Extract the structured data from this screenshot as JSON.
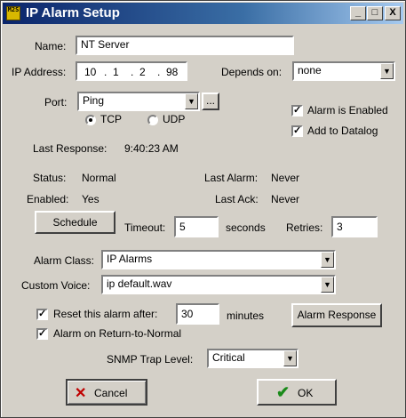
{
  "window": {
    "title": "IP Alarm Setup",
    "icon_text": "M2S"
  },
  "titlebar_buttons": {
    "minimize": "_",
    "maximize": "□",
    "close": "X"
  },
  "name": {
    "label": "Name:",
    "value": "NT Server"
  },
  "ip": {
    "label": "IP Address:",
    "octets": [
      "10",
      "1",
      "2",
      "98"
    ],
    "dot": "."
  },
  "depends": {
    "label": "Depends on:",
    "value": "none"
  },
  "port": {
    "label": "Port:",
    "value": "Ping",
    "browse": "..."
  },
  "protocol": {
    "tcp": "TCP",
    "udp": "UDP",
    "selected": "TCP"
  },
  "alarm_enabled": {
    "label": "Alarm is Enabled",
    "checked": true
  },
  "add_datalog": {
    "label": "Add to Datalog",
    "checked": true
  },
  "last_response": {
    "label": "Last Response:",
    "value": "9:40:23 AM"
  },
  "status": {
    "label": "Status:",
    "value": "Normal"
  },
  "enabled": {
    "label": "Enabled:",
    "value": "Yes"
  },
  "last_alarm": {
    "label": "Last Alarm:",
    "value": "Never"
  },
  "last_ack": {
    "label": "Last Ack:",
    "value": "Never"
  },
  "schedule_label": "Schedule",
  "timeout": {
    "label": "Timeout:",
    "value": "5",
    "unit": "seconds"
  },
  "retries": {
    "label": "Retries:",
    "value": "3"
  },
  "alarm_class": {
    "label": "Alarm Class:",
    "value": "IP Alarms"
  },
  "custom_voice": {
    "label": "Custom Voice:",
    "value": "ip default.wav"
  },
  "reset_after": {
    "label": "Reset this alarm after:",
    "value": "30",
    "unit": "minutes",
    "checked": true
  },
  "alarm_response_label": "Alarm Response",
  "alarm_return": {
    "label": "Alarm on Return-to-Normal",
    "checked": true
  },
  "snmp": {
    "label": "SNMP Trap Level:",
    "value": "Critical"
  },
  "cancel_label": "Cancel",
  "ok_label": "OK",
  "colors": {
    "title_start": "#0a246a",
    "title_end": "#a6caf0",
    "face": "#d4d0c8",
    "cancel_icon": "#c00000",
    "ok_icon": "#1a8a1a"
  }
}
